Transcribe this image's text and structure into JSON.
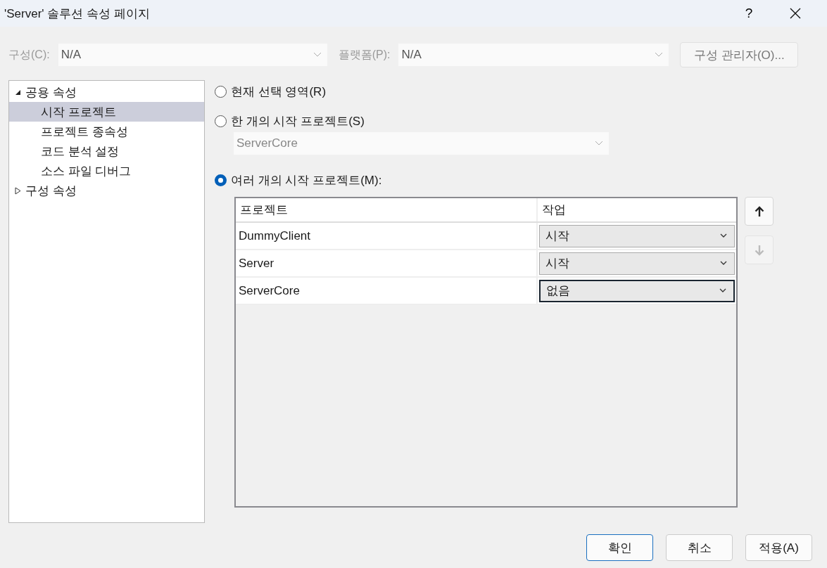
{
  "window": {
    "title": "'Server' 솔루션 속성 페이지",
    "help": "?"
  },
  "config_row": {
    "configuration_label": "구성(C):",
    "configuration_value": "N/A",
    "platform_label": "플랫폼(P):",
    "platform_value": "N/A",
    "manager_button": "구성 관리자(O)...",
    "disabled": true
  },
  "sidebar": {
    "items": [
      {
        "label": "공용 속성",
        "expanded": true,
        "selected": false,
        "children": [
          {
            "label": "시작 프로젝트",
            "selected": true
          },
          {
            "label": "프로젝트 종속성",
            "selected": false
          },
          {
            "label": "코드 분석 설정",
            "selected": false
          },
          {
            "label": "소스 파일 디버그",
            "selected": false
          }
        ]
      },
      {
        "label": "구성 속성",
        "expanded": false,
        "selected": false
      }
    ]
  },
  "startup_options": [
    {
      "label": "현재 선택 영역(R)",
      "selected": false
    },
    {
      "label": "한 개의 시작 프로젝트(S)",
      "selected": false
    },
    {
      "label": "여러 개의 시작 프로젝트(M):",
      "selected": true
    }
  ],
  "single_project_dropdown": {
    "value": "ServerCore",
    "disabled": true
  },
  "table": {
    "columns": [
      "프로젝트",
      "작업"
    ],
    "rows": [
      {
        "project": "DummyClient",
        "action": "시작",
        "focused": false
      },
      {
        "project": "Server",
        "action": "시작",
        "focused": false
      },
      {
        "project": "ServerCore",
        "action": "없음",
        "focused": true
      }
    ]
  },
  "move_buttons": {
    "up_disabled": false,
    "down_disabled": true
  },
  "buttons": [
    {
      "label": "확인",
      "default": true
    },
    {
      "label": "취소",
      "default": false
    },
    {
      "label": "적용(A)",
      "default": false
    }
  ]
}
